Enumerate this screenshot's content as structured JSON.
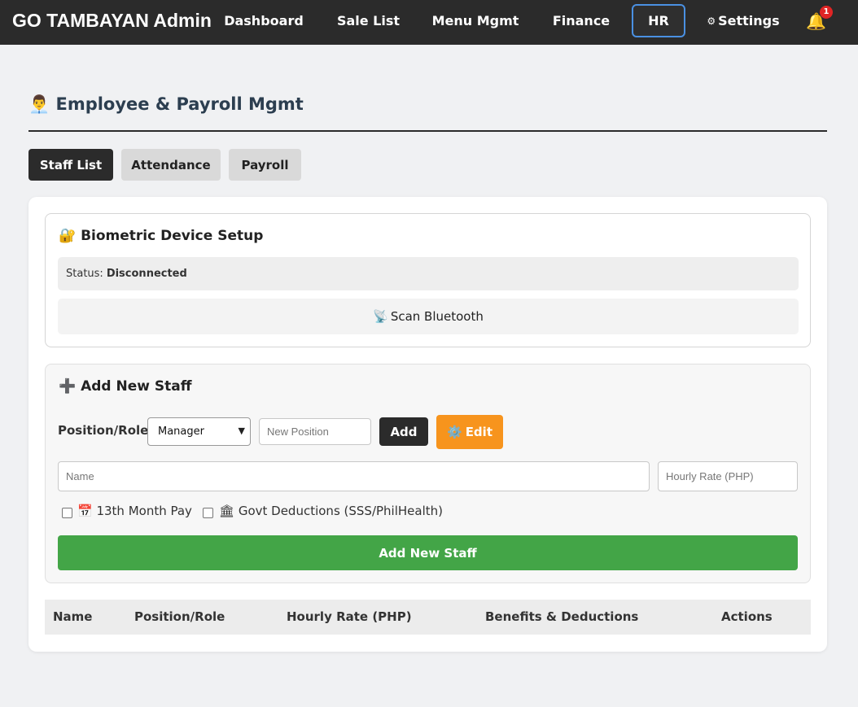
{
  "app": {
    "title": "GO TAMBAYAN Admin"
  },
  "nav": {
    "dashboard": "Dashboard",
    "sale_list": "Sale List",
    "menu_mgmt": "Menu Mgmt",
    "finance": "Finance",
    "hr": "HR",
    "settings_icon": "⚙",
    "settings": "Settings",
    "notification_icon": "🔔",
    "notification_count": "1"
  },
  "page": {
    "icon": "👨‍💼",
    "title": "Employee & Payroll Mgmt"
  },
  "tabs": {
    "staff_list": "Staff List",
    "attendance": "Attendance",
    "payroll": "Payroll"
  },
  "biometric": {
    "icon": "🔐",
    "title": "Biometric Device Setup",
    "status_label": "Status:",
    "status_value": "Disconnected",
    "scan_icon": "📡",
    "scan_label": "Scan Bluetooth"
  },
  "add_staff": {
    "icon": "➕",
    "title": "Add New Staff",
    "position_label": "Position/Role:",
    "position_selected": "Manager",
    "new_position_placeholder": "New Position",
    "add_label": "Add",
    "edit_icon": "⚙️",
    "edit_label": "Edit",
    "name_placeholder": "Name",
    "rate_placeholder": "Hourly Rate (PHP)",
    "thirteenth_icon": "📅",
    "thirteenth_label": "13th Month Pay",
    "govt_icon": "🏛",
    "govt_label": "Govt Deductions (SSS/PhilHealth)",
    "submit_label": "Add New Staff"
  },
  "table": {
    "columns": [
      "Name",
      "Position/Role",
      "Hourly Rate (PHP)",
      "Benefits & Deductions",
      "Actions"
    ]
  },
  "colors": {
    "nav_bg": "#2b2b2b",
    "active_outline": "#4a90e2",
    "edit_orange": "#f7941d",
    "submit_green": "#43a547",
    "badge_red": "#e02424"
  }
}
